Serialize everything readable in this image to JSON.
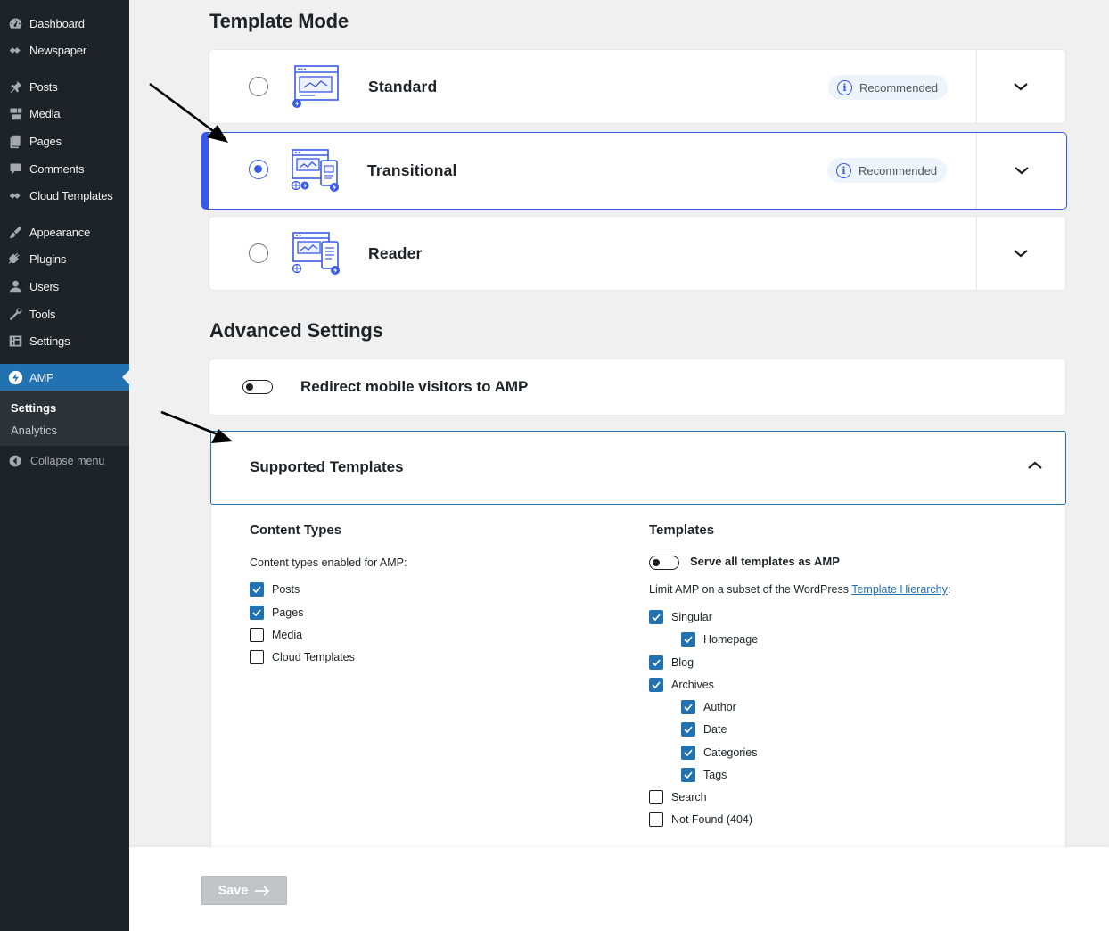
{
  "sidebar": {
    "items": [
      {
        "label": "Dashboard",
        "icon": "dashboard-icon"
      },
      {
        "label": "Newspaper",
        "icon": "newspaper-icon"
      },
      {
        "label": "Posts",
        "icon": "pin-icon"
      },
      {
        "label": "Media",
        "icon": "media-icon"
      },
      {
        "label": "Pages",
        "icon": "pages-icon"
      },
      {
        "label": "Comments",
        "icon": "comment-icon"
      },
      {
        "label": "Cloud Templates",
        "icon": "cloud-templates-icon"
      },
      {
        "label": "Appearance",
        "icon": "brush-icon"
      },
      {
        "label": "Plugins",
        "icon": "plugin-icon"
      },
      {
        "label": "Users",
        "icon": "user-icon"
      },
      {
        "label": "Tools",
        "icon": "wrench-icon"
      },
      {
        "label": "Settings",
        "icon": "settings-icon"
      },
      {
        "label": "AMP",
        "icon": "amp-bolt-icon",
        "active": true
      }
    ],
    "submenu": [
      "Settings",
      "Analytics"
    ],
    "collapse_label": "Collapse menu"
  },
  "template_mode": {
    "title": "Template Mode",
    "modes": [
      {
        "name": "Standard",
        "badge": "Recommended",
        "selected": false
      },
      {
        "name": "Transitional",
        "badge": "Recommended",
        "selected": true
      },
      {
        "name": "Reader",
        "badge": "",
        "selected": false
      }
    ]
  },
  "advanced": {
    "title": "Advanced Settings",
    "redirect_label": "Redirect mobile visitors to AMP",
    "redirect_enabled": false,
    "supported_title": "Supported Templates",
    "content_types": {
      "title": "Content Types",
      "desc": "Content types enabled for AMP:",
      "items": [
        {
          "label": "Posts",
          "checked": true
        },
        {
          "label": "Pages",
          "checked": true
        },
        {
          "label": "Media",
          "checked": false
        },
        {
          "label": "Cloud Templates",
          "checked": false
        }
      ]
    },
    "templates": {
      "title": "Templates",
      "serve_all_label": "Serve all templates as AMP",
      "serve_all_enabled": false,
      "limit_text": "Limit AMP on a subset of the WordPress ",
      "limit_link": "Template Hierarchy",
      "limit_suffix": ":",
      "items": [
        {
          "label": "Singular",
          "checked": true,
          "level": 0
        },
        {
          "label": "Homepage",
          "checked": true,
          "level": 1
        },
        {
          "label": "Blog",
          "checked": true,
          "level": 0
        },
        {
          "label": "Archives",
          "checked": true,
          "level": 0
        },
        {
          "label": "Author",
          "checked": true,
          "level": 1
        },
        {
          "label": "Date",
          "checked": true,
          "level": 1
        },
        {
          "label": "Categories",
          "checked": true,
          "level": 1
        },
        {
          "label": "Tags",
          "checked": true,
          "level": 1
        },
        {
          "label": "Search",
          "checked": false,
          "level": 0
        },
        {
          "label": "Not Found (404)",
          "checked": false,
          "level": 0
        }
      ]
    }
  },
  "footer": {
    "save_label": "Save"
  },
  "colors": {
    "accent": "#3858e9",
    "wp_blue": "#2271b1",
    "sidebar_bg": "#1d2327"
  }
}
